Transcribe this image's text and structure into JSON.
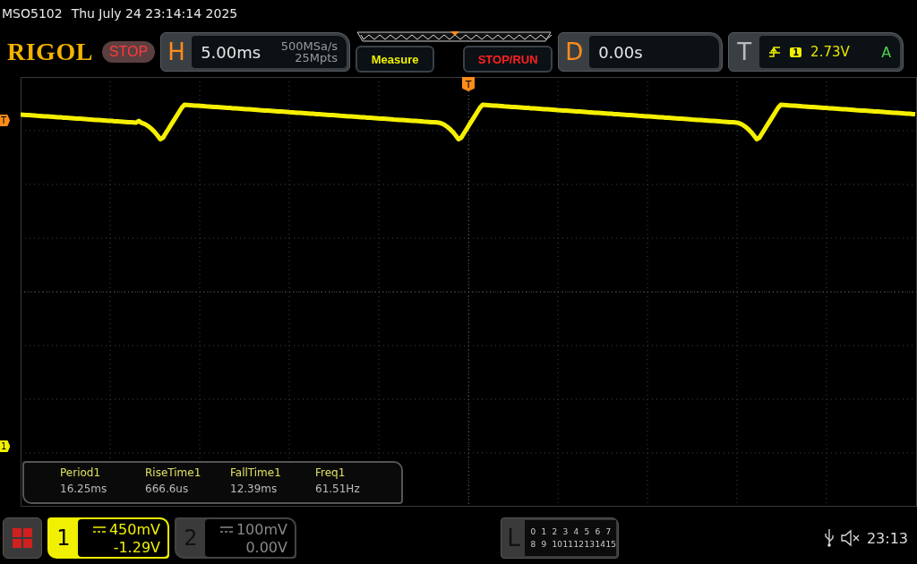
{
  "title_bar": {
    "model": "MSO5102",
    "datetime": "Thu July 24 23:14:14 2025"
  },
  "header": {
    "logo": "RIGOL",
    "run_state": "STOP",
    "horizontal": {
      "label": "H",
      "timebase": "5.00ms",
      "sample_rate": "500MSa/s",
      "memory_depth": "25Mpts"
    },
    "measure_button": "Measure",
    "stop_run_button": "STOP/RUN",
    "delay": {
      "label": "D",
      "value": "0.00s"
    },
    "trigger": {
      "label": "T",
      "source": "1",
      "level": "2.73V",
      "mode": "A"
    }
  },
  "markers": {
    "trigger_top": "T",
    "trigger_left": "T",
    "channel": "1"
  },
  "measurements": [
    {
      "name": "Period1",
      "value": "16.25ms"
    },
    {
      "name": "RiseTime1",
      "value": "666.6us"
    },
    {
      "name": "FallTime1",
      "value": "12.39ms"
    },
    {
      "name": "Freq1",
      "value": "61.51Hz"
    }
  ],
  "channels": [
    {
      "number": "1",
      "scale": "450mV",
      "offset": "-1.29V",
      "selected": true
    },
    {
      "number": "2",
      "scale": "100mV",
      "offset": "0.00V",
      "selected": false
    }
  ],
  "logic": {
    "label": "L",
    "rows": [
      [
        "0",
        "1",
        "2",
        "3",
        "4",
        "5",
        "6",
        "7"
      ],
      [
        "8",
        "9",
        "10",
        "11",
        "12",
        "13",
        "14",
        "15"
      ]
    ]
  },
  "status": {
    "time": "23:13"
  }
}
